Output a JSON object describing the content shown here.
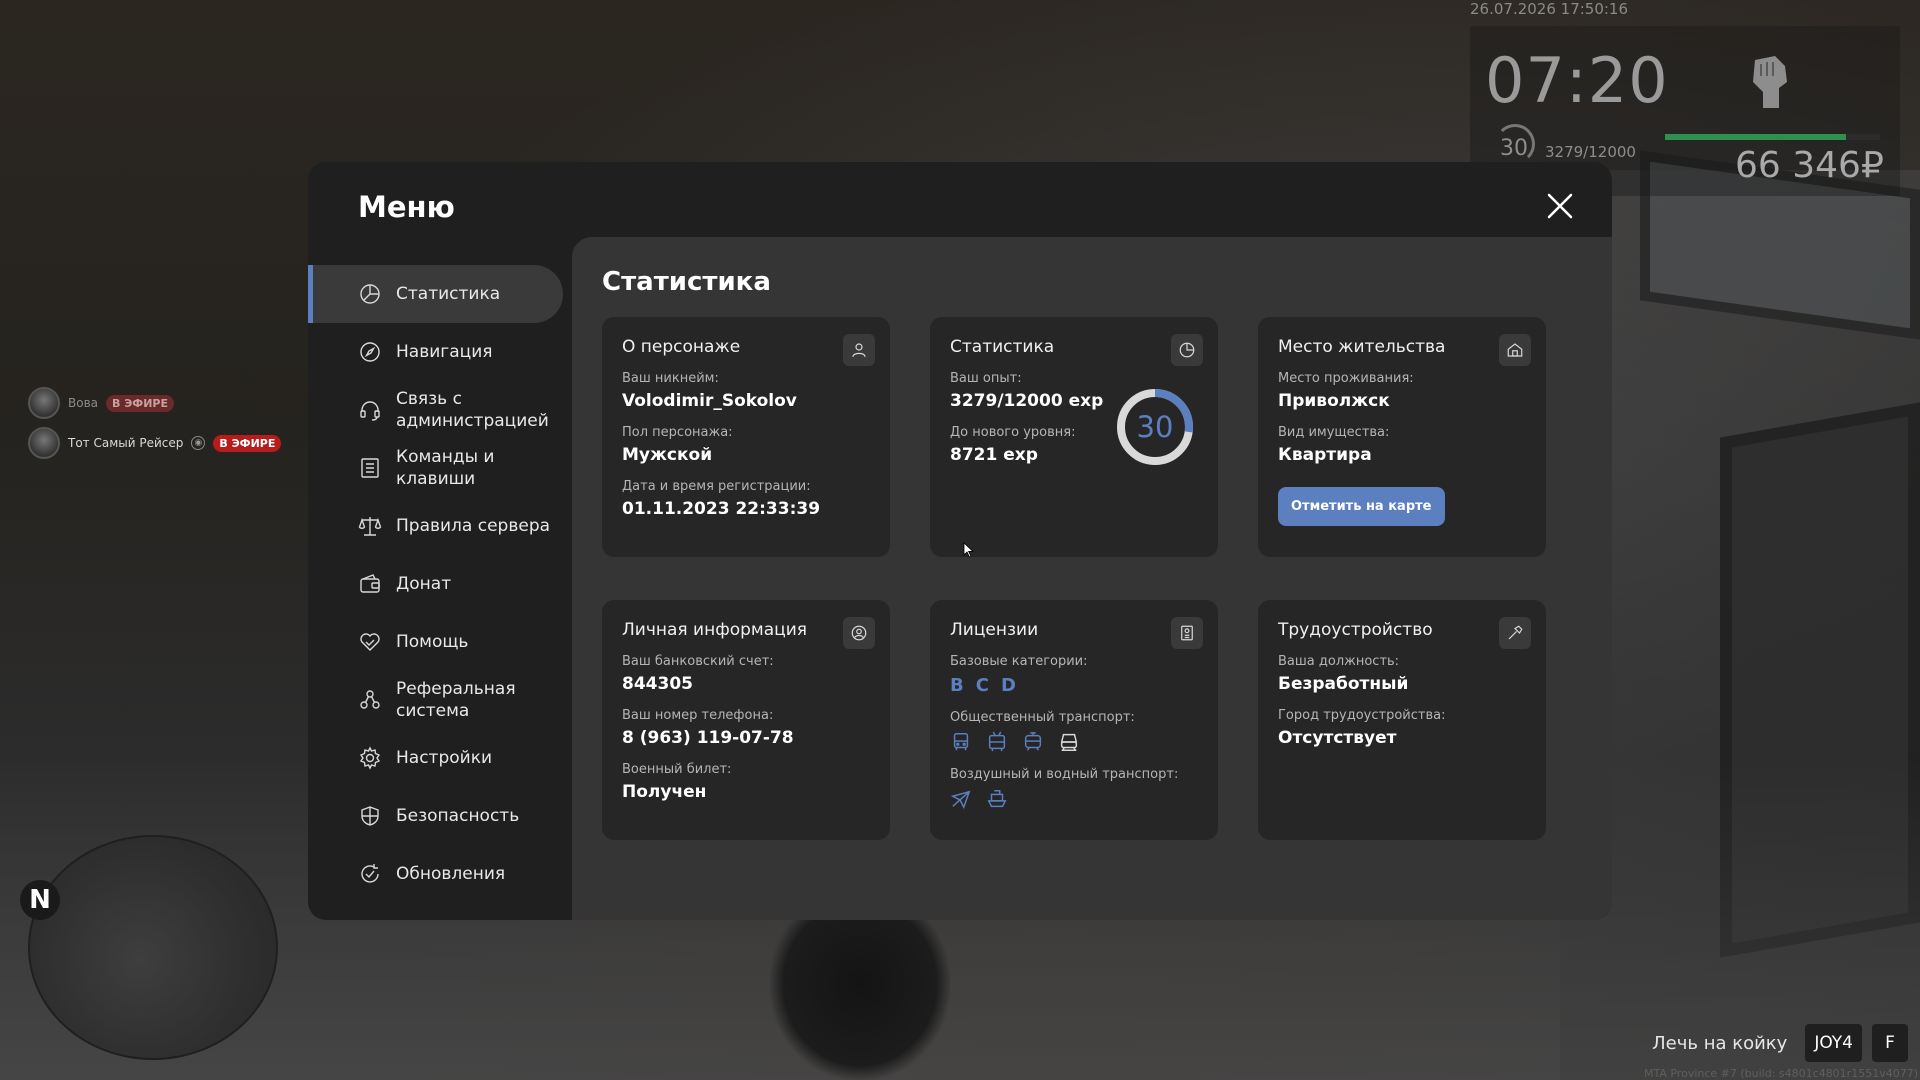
{
  "hud": {
    "datetime": "26.07.2026 17:50:16",
    "clock": "07:20",
    "level": "30",
    "exp": "3279/12000",
    "money": "66 346₽",
    "health_fraction": 0.84,
    "health_color": "#2e8f4e"
  },
  "voice": [
    {
      "name": "Вова",
      "badge": "В ЭФИРЕ"
    },
    {
      "name": "Тот Самый Рейсер",
      "badge": "В ЭФИРЕ"
    }
  ],
  "minimap": {
    "north": "N"
  },
  "prompt": {
    "text": "Лечь на койку",
    "key1": "JOY4",
    "key2": "F"
  },
  "build": "MTA Province #7 (build: s4801c4801r1551v4077)",
  "menu": {
    "title": "Меню",
    "nav": [
      {
        "label": "Статистика",
        "icon": "pie-chart-icon",
        "active": true
      },
      {
        "label": "Навигация",
        "icon": "compass-icon"
      },
      {
        "label": "Связь с администрацией",
        "icon": "headset-icon"
      },
      {
        "label": "Команды и клавиши",
        "icon": "list-icon"
      },
      {
        "label": "Правила сервера",
        "icon": "scales-icon"
      },
      {
        "label": "Донат",
        "icon": "wallet-icon"
      },
      {
        "label": "Помощь",
        "icon": "heart-hand-icon"
      },
      {
        "label": "Реферальная система",
        "icon": "people-icon"
      },
      {
        "label": "Настройки",
        "icon": "gear-icon"
      },
      {
        "label": "Безопасность",
        "icon": "shield-icon"
      },
      {
        "label": "Обновления",
        "icon": "refresh-icon"
      }
    ],
    "accent": "#5b7fbf"
  },
  "stats": {
    "title": "Статистика",
    "character": {
      "title": "О персонаже",
      "nick_label": "Ваш никнейм:",
      "nick": "Volodimir_Sokolov",
      "gender_label": "Пол персонажа:",
      "gender": "Мужской",
      "reg_label": "Дата и время регистрации:",
      "reg": "01.11.2023 22:33:39"
    },
    "statistics": {
      "title": "Статистика",
      "exp_label": "Ваш опыт:",
      "exp": "3279/12000 exp",
      "next_label": "До нового уровня:",
      "next": "8721 exp",
      "level": "30",
      "progress_fraction": 0.273
    },
    "residence": {
      "title": "Место жительства",
      "place_label": "Место проживания:",
      "place": "Приволжск",
      "type_label": "Вид имущества:",
      "type": "Квартира",
      "button": "Отметить на карте"
    },
    "personal": {
      "title": "Личная информация",
      "bank_label": "Ваш банковский счет:",
      "bank": "844305",
      "phone_label": "Ваш номер телефона:",
      "phone": "8 (963) 119-07-78",
      "military_label": "Военный билет:",
      "military": "Получен"
    },
    "licenses": {
      "title": "Лицензии",
      "base_label": "Базовые категории:",
      "categories": [
        "B",
        "C",
        "D"
      ],
      "public_label": "Общественный транспорт:",
      "public_icons": [
        "bus-icon",
        "trolleybus-icon",
        "tram-icon",
        "train-icon"
      ],
      "air_label": "Воздушный и водный транспорт:",
      "air_icons": [
        "plane-icon",
        "boat-icon"
      ]
    },
    "employment": {
      "title": "Трудоустройство",
      "position_label": "Ваша должность:",
      "position": "Безработный",
      "city_label": "Город трудоустройства:",
      "city": "Отсутствует"
    }
  }
}
